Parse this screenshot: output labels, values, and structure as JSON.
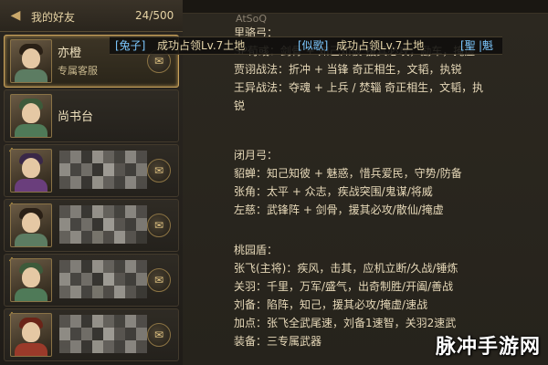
{
  "friends_panel": {
    "title": "我的好友",
    "count": "24/500",
    "friends": [
      {
        "name": "亦橙",
        "subtitle": "专属客服",
        "mail": "✉"
      },
      {
        "name": "尚书台",
        "subtitle": "",
        "mail": ""
      },
      {
        "name": "",
        "subtitle": "",
        "mail": "✉"
      },
      {
        "name": "",
        "subtitle": "",
        "mail": "✉"
      },
      {
        "name": "",
        "subtitle": "",
        "mail": "✉"
      },
      {
        "name": "",
        "subtitle": "",
        "mail": "✉"
      }
    ]
  },
  "marquee": {
    "tag1": "[兔子]",
    "msg1": "成功占领Lv.7土地",
    "tag2": "[似歌]",
    "msg2": "成功占领Lv.7土地",
    "tag3": "[聖",
    "tag4": "|魁"
  },
  "info_panel": {
    "top_tag": "AtSoQ",
    "section1": [
      "里骆弓：",
      "SP荀彧：剑骨 + 知己知彼 援其必攻，励车，掩虚",
      "贾诩战法：折冲 + 当锋  奇正相生，文韬，执锐",
      "王异战法：夺魂 + 上兵 / 焚辎 奇正相生，文韬，执",
      "锐"
    ],
    "section2": [
      "闭月弓：",
      "貂蝉：知己知彼 + 魅惑，惜兵爱民，守势/防备",
      "张角：太平 + 众志，疾战突围/鬼谋/将威",
      "左慈：武锋阵 + 剑骨，援其必攻/散仙/掩虚"
    ],
    "section3": [
      "桃园盾：",
      "张飞(主将)：疾风，击其，应机立断/久战/锤炼",
      "关羽：千里，万军/盛气，出奇制胜/开阖/善战",
      "刘备：陷阵，知己，援其必攻/掩虚/速战",
      "加点：张飞全武尾速，刘备1速智，关羽2速武",
      "装备：三专属武器"
    ]
  },
  "watermark": "脉冲手游网"
}
